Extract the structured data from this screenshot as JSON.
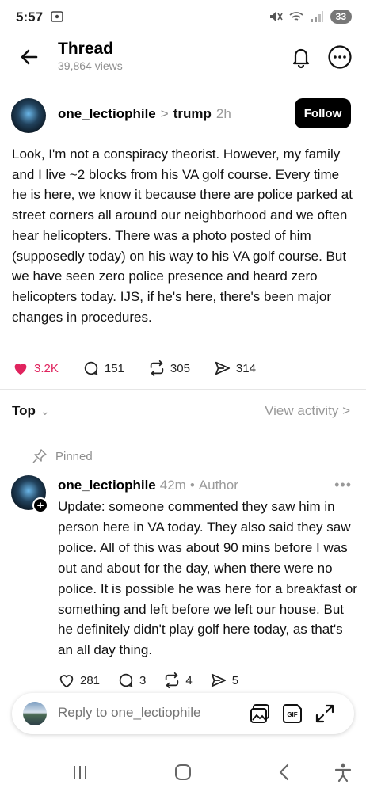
{
  "status": {
    "time": "5:57",
    "battery": "33"
  },
  "header": {
    "title": "Thread",
    "views": "39,864 views"
  },
  "post": {
    "username": "one_lectiophile",
    "topic": "trump",
    "time": "2h",
    "follow_label": "Follow",
    "body": "Look, I'm not a conspiracy theorist. However, my family and I live ~2 blocks from his VA golf course. Every time he is here, we know it because there are police parked at street corners all around our neighborhood and we often hear helicopters. There was a photo posted of him (supposedly today) on his way to his VA golf course. But we have seen zero police presence and heard zero helicopters today. IJS, if he's here, there's been major changes in procedures.",
    "likes": "3.2K",
    "comments": "151",
    "reposts": "305",
    "shares": "314"
  },
  "sort": {
    "label": "Top",
    "view_activity": "View activity >"
  },
  "pinned_label": "Pinned",
  "reply": {
    "username": "one_lectiophile",
    "time": "42m",
    "author_tag": "Author",
    "body": "Update: someone commented they saw him in person here in VA today. They also said they saw police. All of this was about 90 mins before I was out and about for the day, when there were no police. It is possible he was here for a breakfast or something and left before we left our house. But he definitely didn't play golf here today, as that's an all day thing.",
    "likes": "281",
    "comments": "3",
    "reposts": "4",
    "shares": "5"
  },
  "reply_bar": {
    "placeholder": "Reply to one_lectiophile"
  },
  "colors": {
    "like_red": "#e0245e",
    "muted_gray": "#8f8f8f",
    "follow_bg": "#000000"
  },
  "icons": [
    "back-arrow-icon",
    "bell-icon",
    "more-icon",
    "heart-icon",
    "comment-icon",
    "repost-icon",
    "share-icon",
    "pin-icon",
    "image-icon",
    "gif-icon",
    "expand-icon"
  ]
}
